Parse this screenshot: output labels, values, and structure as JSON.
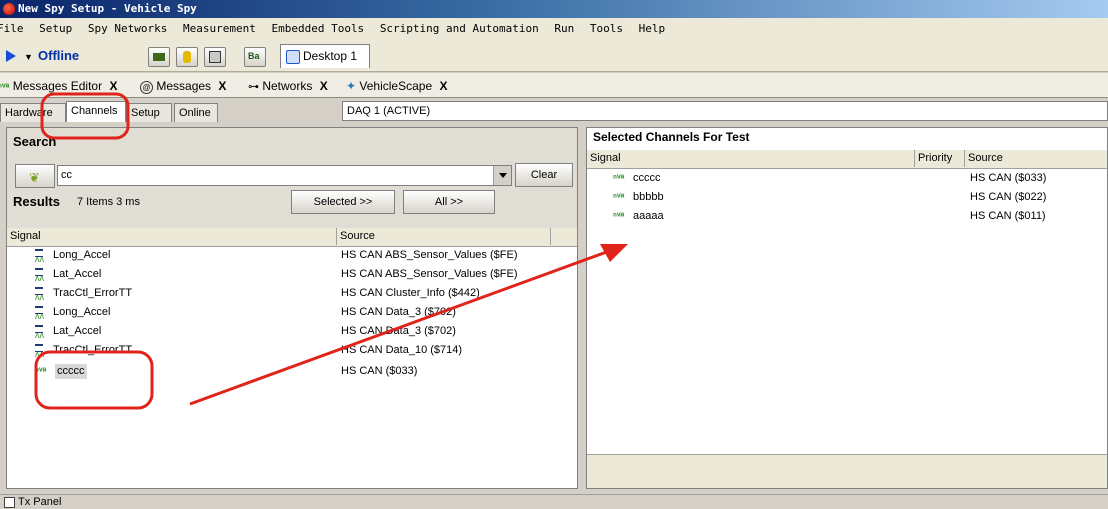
{
  "window": {
    "title": "New Spy Setup - Vehicle Spy"
  },
  "menu": [
    "File",
    "Setup",
    "Spy Networks",
    "Measurement",
    "Embedded Tools",
    "Scripting and Automation",
    "Run",
    "Tools",
    "Help"
  ],
  "toolbar": {
    "status": "Offline",
    "desktop_tab": "Desktop 1"
  },
  "doc_tabs": [
    {
      "label": "Messages Editor",
      "close": "X"
    },
    {
      "label": "Messages",
      "close": "X"
    },
    {
      "label": "Networks",
      "close": "X"
    },
    {
      "label": "VehicleScape",
      "close": "X"
    }
  ],
  "sub_tabs": [
    "Hardware",
    "Channels",
    "Setup",
    "Online"
  ],
  "daq": "DAQ 1 (ACTIVE)",
  "search": {
    "title": "Search",
    "value": "cc",
    "clear_label": "Clear",
    "results_label": "Results",
    "results_count": "7 Items 3 ms",
    "selected_label": "Selected >>",
    "all_label": "All >>"
  },
  "results_table": {
    "headers": [
      "Signal",
      "Source"
    ],
    "rows": [
      {
        "signal": "Long_Accel",
        "source": "HS CAN ABS_Sensor_Values ($FE)"
      },
      {
        "signal": "Lat_Accel",
        "source": "HS CAN ABS_Sensor_Values ($FE)"
      },
      {
        "signal": "TracCtl_ErrorTT",
        "source": "HS CAN Cluster_Info ($442)"
      },
      {
        "signal": "Long_Accel",
        "source": "HS CAN Data_3 ($702)"
      },
      {
        "signal": "Lat_Accel",
        "source": "HS CAN Data_3 ($702)"
      },
      {
        "signal": "TracCtl_ErrorTT",
        "source": "HS CAN Data_10 ($714)"
      },
      {
        "signal": "ccccc",
        "source": "HS CAN ($033)"
      }
    ]
  },
  "selected_channels": {
    "title": "Selected Channels For Test",
    "headers": [
      "Signal",
      "Priority",
      "Source"
    ],
    "rows": [
      {
        "signal": "ccccc",
        "source": "HS CAN ($033)"
      },
      {
        "signal": "bbbbb",
        "source": "HS CAN ($022)"
      },
      {
        "signal": "aaaaa",
        "source": "HS CAN ($011)"
      }
    ]
  },
  "bottom": {
    "label": "Tx Panel"
  },
  "colors": {
    "annotation": "#e0241b",
    "title_bar": "#0a246a",
    "status_text": "#002fa8"
  }
}
